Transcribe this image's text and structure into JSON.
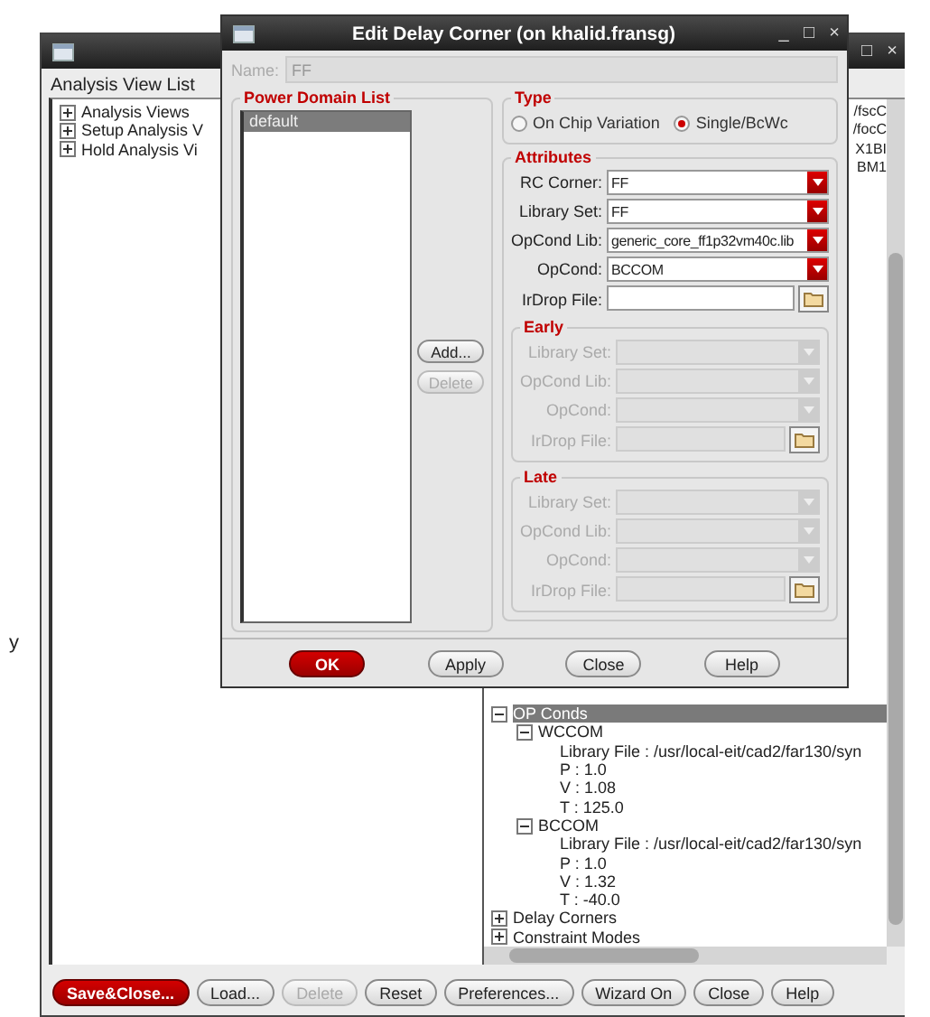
{
  "stray_text": "y",
  "main_window": {
    "window_buttons": [
      "□",
      "×"
    ],
    "heading": "Analysis View List",
    "left_tree": [
      {
        "label": "Analysis Views",
        "expanded": false
      },
      {
        "label": "Setup Analysis V",
        "expanded": false
      },
      {
        "label": "Hold Analysis Vi",
        "expanded": false
      }
    ],
    "right_fragments": [
      "/fscC",
      "/focC",
      "X1BI",
      "BM1"
    ],
    "right_tree": [
      {
        "label": "OP Conds",
        "expanded": true,
        "selected": true,
        "children": [
          {
            "label": "WCCOM",
            "expanded": true,
            "selected": false,
            "children": [
              {
                "label": "Library File : /usr/local-eit/cad2/far130/syn",
                "selected": false
              },
              {
                "label": "P : 1.0",
                "selected": false
              },
              {
                "label": "V : 1.08",
                "selected": false
              },
              {
                "label": "T : 125.0",
                "selected": false
              }
            ]
          },
          {
            "label": "BCCOM",
            "expanded": true,
            "selected": false,
            "children": [
              {
                "label": "Library File : /usr/local-eit/cad2/far130/syn",
                "selected": false
              },
              {
                "label": "P : 1.0",
                "selected": false
              },
              {
                "label": "V : 1.32",
                "selected": false
              },
              {
                "label": "T : -40.0",
                "selected": false
              }
            ]
          }
        ]
      },
      {
        "label": "Delay Corners",
        "expanded": false,
        "selected": false
      },
      {
        "label": "Constraint Modes",
        "expanded": false,
        "selected": false
      }
    ],
    "buttons": [
      {
        "label": "Save&Close...",
        "kind": "primary",
        "disabled": false
      },
      {
        "label": "Load...",
        "kind": "normal",
        "disabled": false
      },
      {
        "label": "Delete",
        "kind": "normal",
        "disabled": true
      },
      {
        "label": "Reset",
        "kind": "normal",
        "disabled": false
      },
      {
        "label": "Preferences...",
        "kind": "normal",
        "disabled": false
      },
      {
        "label": "Wizard On",
        "kind": "normal",
        "disabled": false
      },
      {
        "label": "Close",
        "kind": "normal",
        "disabled": false
      },
      {
        "label": "Help",
        "kind": "normal",
        "disabled": false
      }
    ]
  },
  "dialog": {
    "title": "Edit Delay Corner (on khalid.fransg)",
    "window_buttons": [
      "_",
      "□",
      "×"
    ],
    "name": {
      "label": "Name:",
      "value": "FF",
      "disabled": true
    },
    "power_domain": {
      "title": "Power Domain List",
      "items": [
        {
          "label": "default",
          "selected": true
        }
      ],
      "buttons": [
        {
          "label": "Add...",
          "disabled": false
        },
        {
          "label": "Delete",
          "disabled": true
        }
      ]
    },
    "type": {
      "title": "Type",
      "options": [
        {
          "label": "On Chip Variation",
          "selected": false
        },
        {
          "label": "Single/BcWc",
          "selected": true
        }
      ]
    },
    "attributes": {
      "title": "Attributes",
      "fields": [
        {
          "label": "RC Corner:",
          "value": "FF",
          "kind": "dropdown",
          "disabled": false
        },
        {
          "label": "Library Set:",
          "value": "FF",
          "kind": "dropdown",
          "disabled": false
        },
        {
          "label": "OpCond Lib:",
          "value": "generic_core_ff1p32vm40c.lib",
          "kind": "dropdown",
          "disabled": false
        },
        {
          "label": "OpCond:",
          "value": "BCCOM",
          "kind": "dropdown",
          "disabled": false
        },
        {
          "label": "IrDrop File:",
          "kind": "file",
          "disabled": false
        }
      ],
      "groups": [
        {
          "title": "Early",
          "fields": [
            {
              "label": "Library Set:",
              "kind": "dropdown",
              "disabled": true
            },
            {
              "label": "OpCond Lib:",
              "kind": "dropdown",
              "disabled": true
            },
            {
              "label": "OpCond:",
              "kind": "dropdown",
              "disabled": true
            },
            {
              "label": "IrDrop File:",
              "kind": "file",
              "disabled": true
            }
          ]
        },
        {
          "title": "Late",
          "fields": [
            {
              "label": "Library Set:",
              "kind": "dropdown",
              "disabled": true
            },
            {
              "label": "OpCond Lib:",
              "kind": "dropdown",
              "disabled": true
            },
            {
              "label": "OpCond:",
              "kind": "dropdown",
              "disabled": true
            },
            {
              "label": "IrDrop File:",
              "kind": "file",
              "disabled": true
            }
          ]
        }
      ]
    },
    "buttons": [
      {
        "label": "OK",
        "kind": "primary",
        "disabled": false
      },
      {
        "label": "Apply",
        "kind": "normal",
        "disabled": false
      },
      {
        "label": "Close",
        "kind": "normal",
        "disabled": false
      },
      {
        "label": "Help",
        "kind": "normal",
        "disabled": false
      }
    ]
  }
}
